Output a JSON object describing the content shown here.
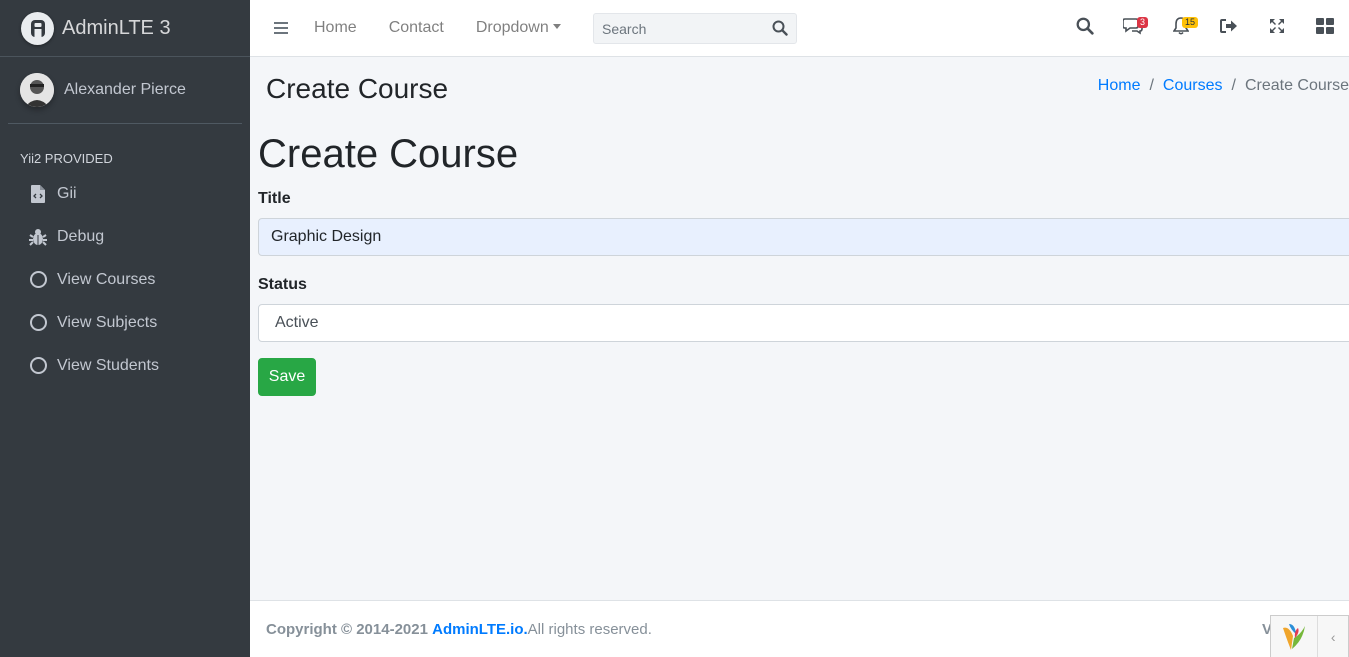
{
  "brand": {
    "name": "AdminLTE 3"
  },
  "user": {
    "name": "Alexander Pierce"
  },
  "sidebar": {
    "header": "Yii2 PROVIDED",
    "items": [
      {
        "label": "Gii",
        "icon": "file-code-icon"
      },
      {
        "label": "Debug",
        "icon": "bug-icon"
      },
      {
        "label": "View Courses",
        "icon": "circle-icon"
      },
      {
        "label": "View Subjects",
        "icon": "circle-icon"
      },
      {
        "label": "View Students",
        "icon": "circle-icon"
      }
    ]
  },
  "navbar": {
    "links": [
      "Home",
      "Contact",
      "Dropdown"
    ],
    "search_placeholder": "Search",
    "messages_count": "3",
    "notifications_count": "15"
  },
  "page": {
    "header_title": "Create Course",
    "breadcrumb": [
      "Home",
      "Courses",
      "Create Course"
    ],
    "form_title": "Create Course"
  },
  "form": {
    "title_label": "Title",
    "title_value": "Graphic Design",
    "status_label": "Status",
    "status_value": "Active",
    "save_label": "Save"
  },
  "footer": {
    "copyright_prefix": "Copyright © 2014-2021",
    "link_text": "AdminLTE.io.",
    "suffix": " All rights reserved.",
    "version": "V"
  },
  "colors": {
    "sidebar_bg": "#343a40",
    "link": "#007bff",
    "success": "#28a745",
    "danger": "#dc3545",
    "warning": "#ffc107"
  }
}
